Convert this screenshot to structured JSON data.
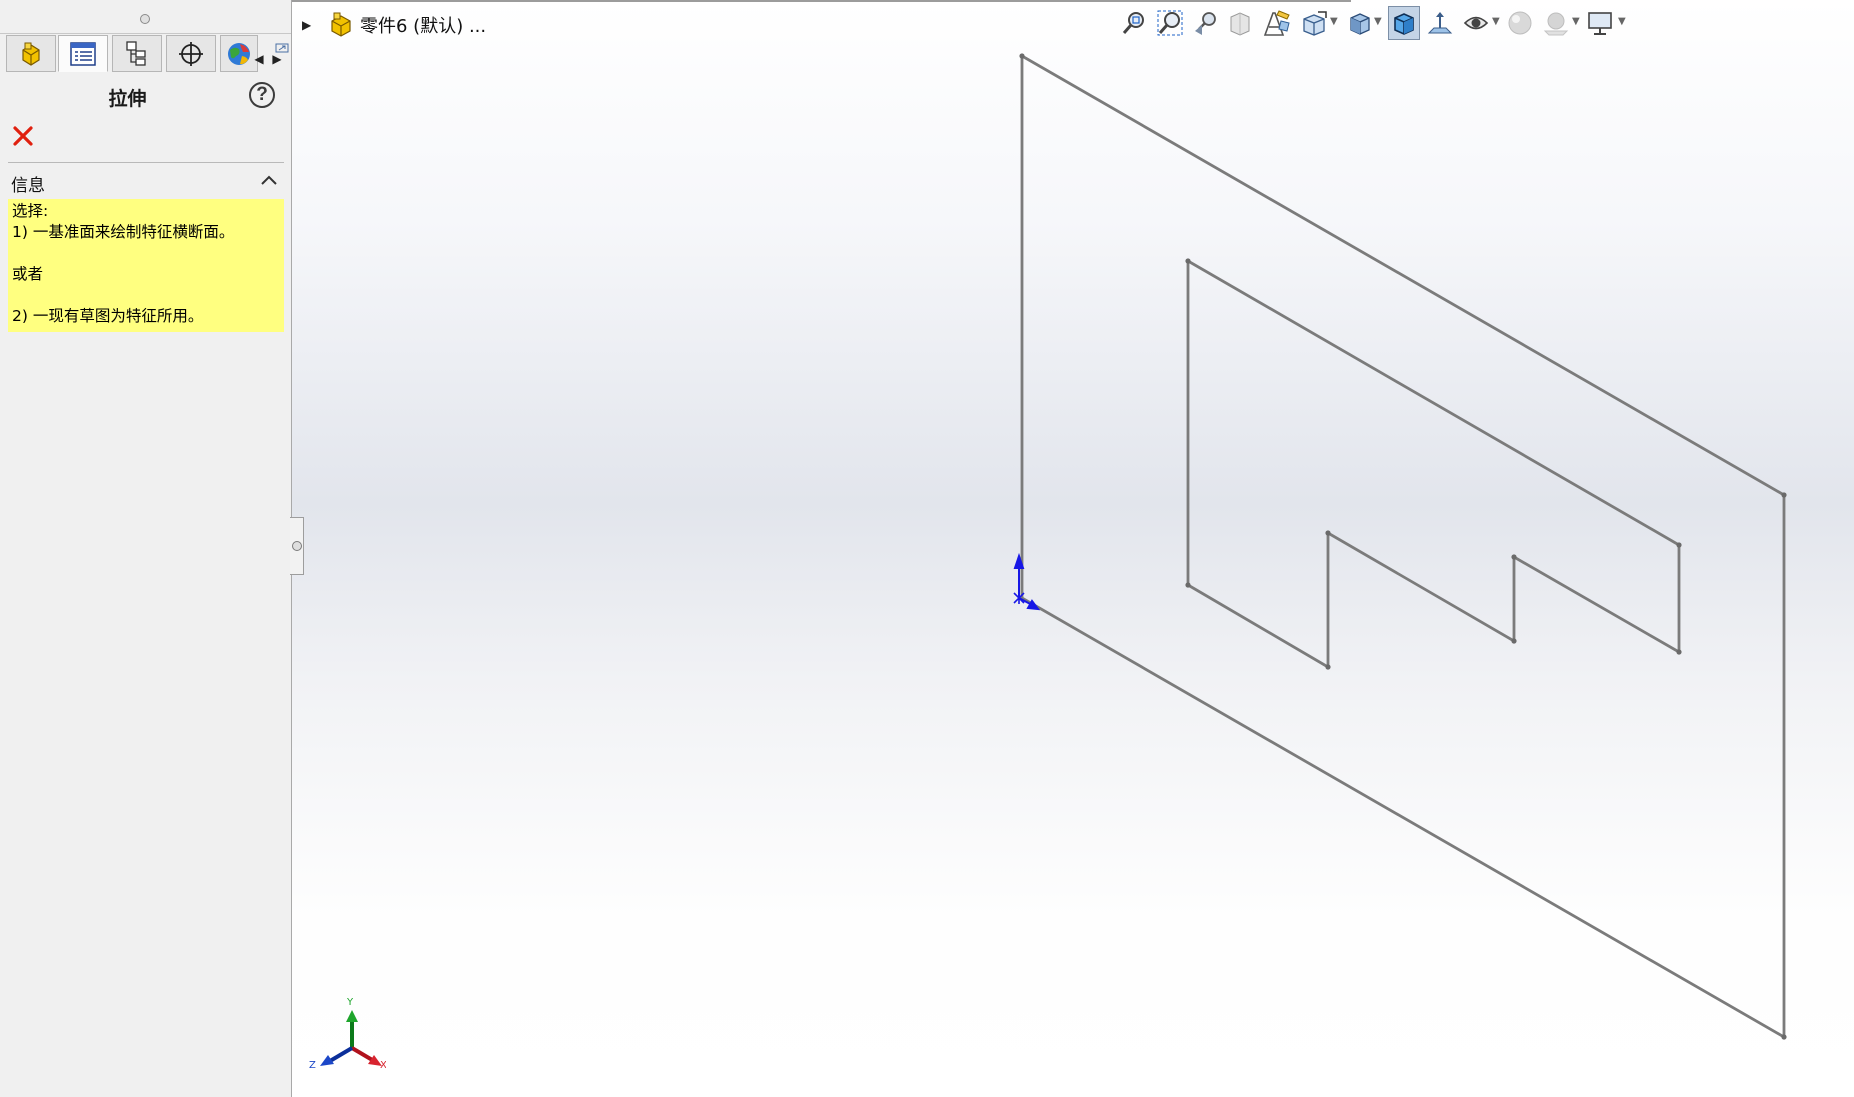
{
  "panel": {
    "title": "拉伸",
    "help_label": "?",
    "tabs": [
      {
        "name": "FeatureManager design tree",
        "icon": "part-tree-icon"
      },
      {
        "name": "PropertyManager",
        "icon": "property-list-icon"
      },
      {
        "name": "ConfigurationManager",
        "icon": "configuration-icon"
      },
      {
        "name": "DimXpertManager",
        "icon": "crosshair-icon"
      },
      {
        "name": "DisplayManager",
        "icon": "display-globe-icon"
      }
    ],
    "info_section": {
      "header": "信息",
      "lines": [
        "选择:",
        "1) 一基准面来绘制特征横断面。",
        "",
        "或者",
        "",
        "2) 一现有草图为特征所用。"
      ]
    }
  },
  "graphics": {
    "tree_item_label": "零件6 (默认) ...",
    "triad": {
      "y": "Y",
      "x": "X",
      "z": "Z"
    },
    "toolbar_icons": [
      "zoom-to-fit-icon",
      "zoom-to-area-icon",
      "previous-view-icon",
      "section-view-icon",
      "dynamic-annotation-views-icon",
      "view-orientation-icon",
      "display-style-icon",
      "shaded-with-edges-icon",
      "show-orientation-icon",
      "hide-show-items-icon",
      "edit-appearance-icon",
      "apply-scene-icon",
      "view-settings-icon"
    ]
  },
  "colors": {
    "sketch_line": "#7b7b7b",
    "origin": "#1717e6",
    "info_bg": "#ffff80",
    "cancel": "#e0200f"
  }
}
